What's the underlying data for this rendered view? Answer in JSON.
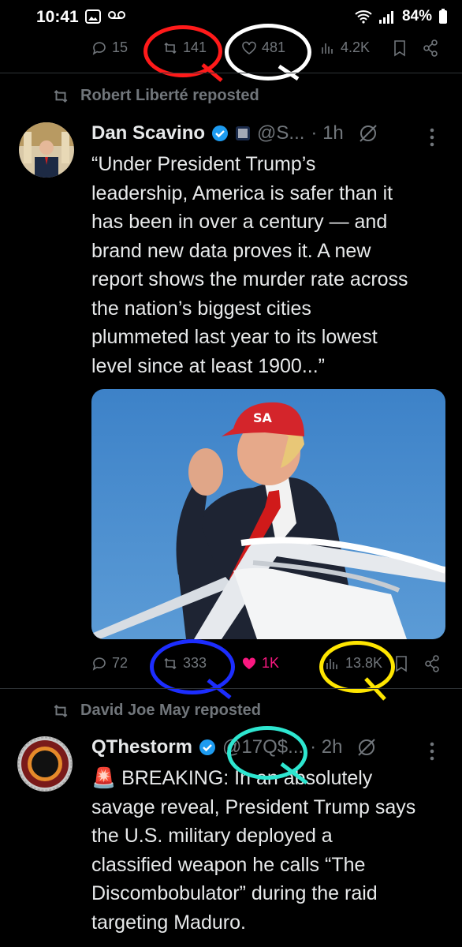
{
  "status_bar": {
    "time": "10:41",
    "battery": "84%"
  },
  "top_actions": {
    "replies": "15",
    "reposts": "141",
    "likes": "481",
    "views": "4.2K"
  },
  "post1": {
    "reposted_by": "Robert Liberté reposted",
    "author": "Dan Scavino",
    "handle": "@S...",
    "time": "· 1h",
    "text": "“Under President Trump’s\nleadership, America is safer than it\nhas been in over a century — and\nbrand new data proves it. A new\nreport shows the murder rate across\nthe nation’s biggest cities\nplummeted last year to its lowest\nlevel since at least 1900...”",
    "actions": {
      "replies": "72",
      "reposts": "333",
      "likes": "1K",
      "views": "13.8K"
    }
  },
  "post2": {
    "reposted_by": "David Joe May reposted",
    "author": "QThestorm",
    "handle": "@17Q$...",
    "time": "· 2h",
    "text": "🚨 BREAKING: In an absolutely\nsavage reveal, President Trump says\nthe U.S. military deployed a\nclassified weapon he calls “The\nDiscombobulator” during the raid\ntargeting Maduro."
  },
  "colors": {
    "like_active": "#f91880",
    "verified": "#1d9bf0",
    "muted": "#71767b"
  }
}
